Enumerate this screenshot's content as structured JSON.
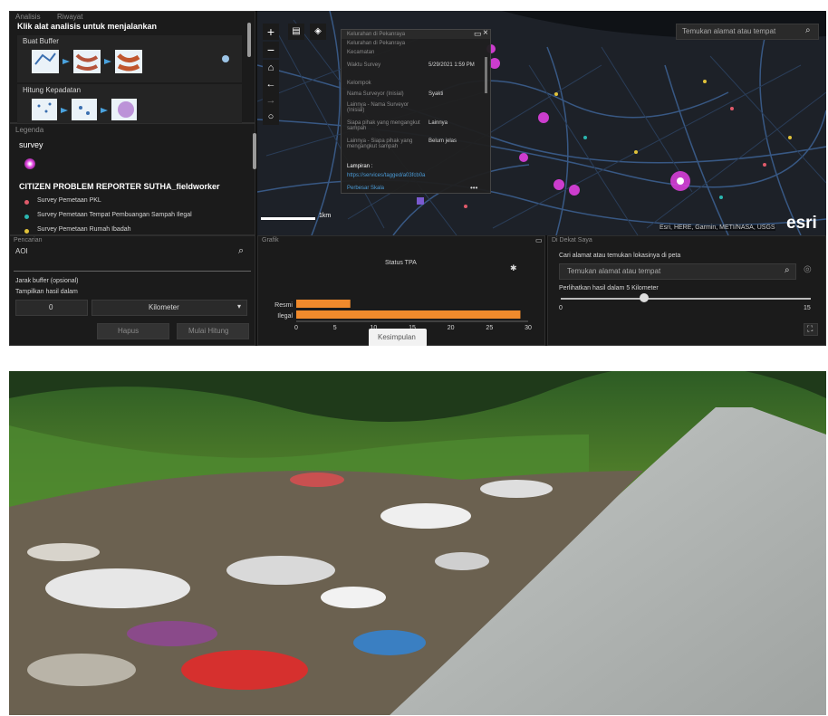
{
  "analysis": {
    "tabs": [
      "Analisis",
      "Riwayat"
    ],
    "heading": "Klik alat analisis untuk menjalankan",
    "tools": [
      {
        "label": "Buat Buffer"
      },
      {
        "label": "Hitung Kepadatan"
      }
    ]
  },
  "legend": {
    "title": "Legenda",
    "layer1": "survey",
    "layer2": "CITIZEN PROBLEM REPORTER SUTHA_fieldworker",
    "items": [
      {
        "label": "Survey Pemetaan PKL",
        "color": "#e05a6a"
      },
      {
        "label": "Survey Pemetaan Tempat Pembuangan Sampah Ilegal",
        "color": "#2bb6b0"
      },
      {
        "label": "Survey Pemetaan Rumah Ibadah",
        "color": "#e0c23a"
      }
    ],
    "symbol_color": "#e040e0"
  },
  "popup": {
    "rows": [
      {
        "k": "Kelurahan di Pekanraya",
        "v": ""
      },
      {
        "k": "Kelurahan di Pekanraya",
        "v": ""
      },
      {
        "k": "Kecamatan",
        "v": ""
      },
      {
        "k": "Waktu Survey",
        "v": "5/29/2021 1:59 PM"
      },
      {
        "k": "Kelompok",
        "v": ""
      },
      {
        "k": "Nama Surveyor (Inisial)",
        "v": "Syakti"
      },
      {
        "k": "Lainnya - Nama Surveyor (Inisial)",
        "v": ""
      },
      {
        "k": "Siapa pihak yang mengangkut sampah",
        "v": "Lainnya"
      },
      {
        "k": "Lainnya - Siapa pihak yang mengangkut sampah",
        "v": "Belum jelas"
      },
      {
        "k": "Lampiran :",
        "v": ""
      }
    ],
    "link": "https://services/tagged/a03fcb0a",
    "footer": "Perbesar Skala"
  },
  "map": {
    "search_placeholder": "Temukan alamat atau tempat",
    "attribution": "Esri, HERE, Garmin, METI/NASA, USGS",
    "logo": "esri",
    "scale_label": "1km"
  },
  "proximity": {
    "title": "Pencarian",
    "aoi_label": "AOI",
    "buffer_label": "Jarak buffer (opsional)",
    "results_label": "Tampilkan hasil dalam",
    "distance_value": "0",
    "unit": "Kilometer",
    "btn_clear": "Hapus",
    "btn_start": "Mulai Hitung"
  },
  "chart_panel": {
    "title": "Grafik",
    "chart_title": "Status TPA",
    "more_button": "Kesimpulan"
  },
  "chart_data": {
    "type": "bar",
    "orientation": "horizontal",
    "title": "Status TPA",
    "categories": [
      "Resmi",
      "Ilegal"
    ],
    "values": [
      7,
      29
    ],
    "xlim": [
      0,
      30
    ],
    "xticks": [
      0,
      5,
      10,
      15,
      20,
      25,
      30
    ],
    "bar_color": "#f08a2c"
  },
  "locate": {
    "title": "Di Dekat Saya",
    "prompt": "Cari alamat atau temukan lokasinya di peta",
    "search_placeholder": "Temukan alamat atau tempat",
    "radius_label": "Perlihatkan hasil dalam 5 Kilometer",
    "slider_min": "0",
    "slider_max": "15",
    "slider_value": 5
  },
  "photo": {
    "subject": "roadside illegal garbage dump"
  }
}
